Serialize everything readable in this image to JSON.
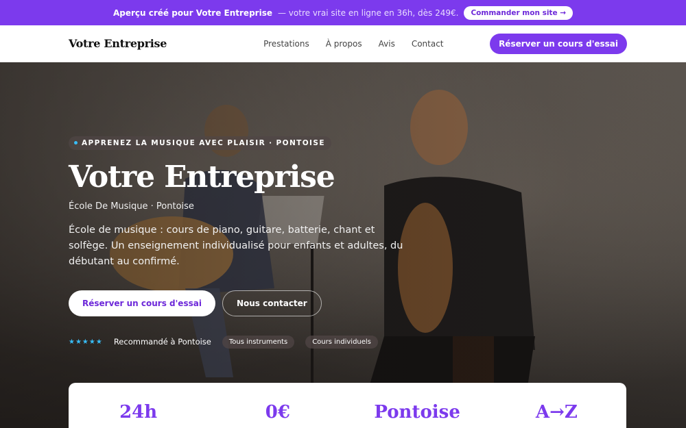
{
  "promo": {
    "bold": "Aperçu créé pour Votre Entreprise",
    "text": "— votre vrai site en ligne en 36h, dès 249€.",
    "button": "Commander mon site →"
  },
  "nav": {
    "logo": "Votre Entreprise",
    "items": [
      "Prestations",
      "À propos",
      "Avis",
      "Contact"
    ],
    "cta": "Réserver un cours d'essai"
  },
  "hero": {
    "kicker": "Apprenez la musique avec plaisir · Pontoise",
    "title": "Votre Entreprise",
    "subtitle": "École De Musique · Pontoise",
    "description": "École de musique : cours de piano, guitare, batterie, chant et solfège. Un enseignement individualisé pour enfants et adultes, du débutant au confirmé.",
    "cta_primary": "Réserver un cours d'essai",
    "cta_secondary": "Nous contacter",
    "stars": "★★★★★",
    "recommendation": "Recommandé à Pontoise",
    "chips": [
      "Tous instruments",
      "Cours individuels"
    ]
  },
  "stats": [
    "24h",
    "0€",
    "Pontoise",
    "A→Z"
  ],
  "colors": {
    "accent": "#7c3aed",
    "star": "#38bdf8"
  }
}
